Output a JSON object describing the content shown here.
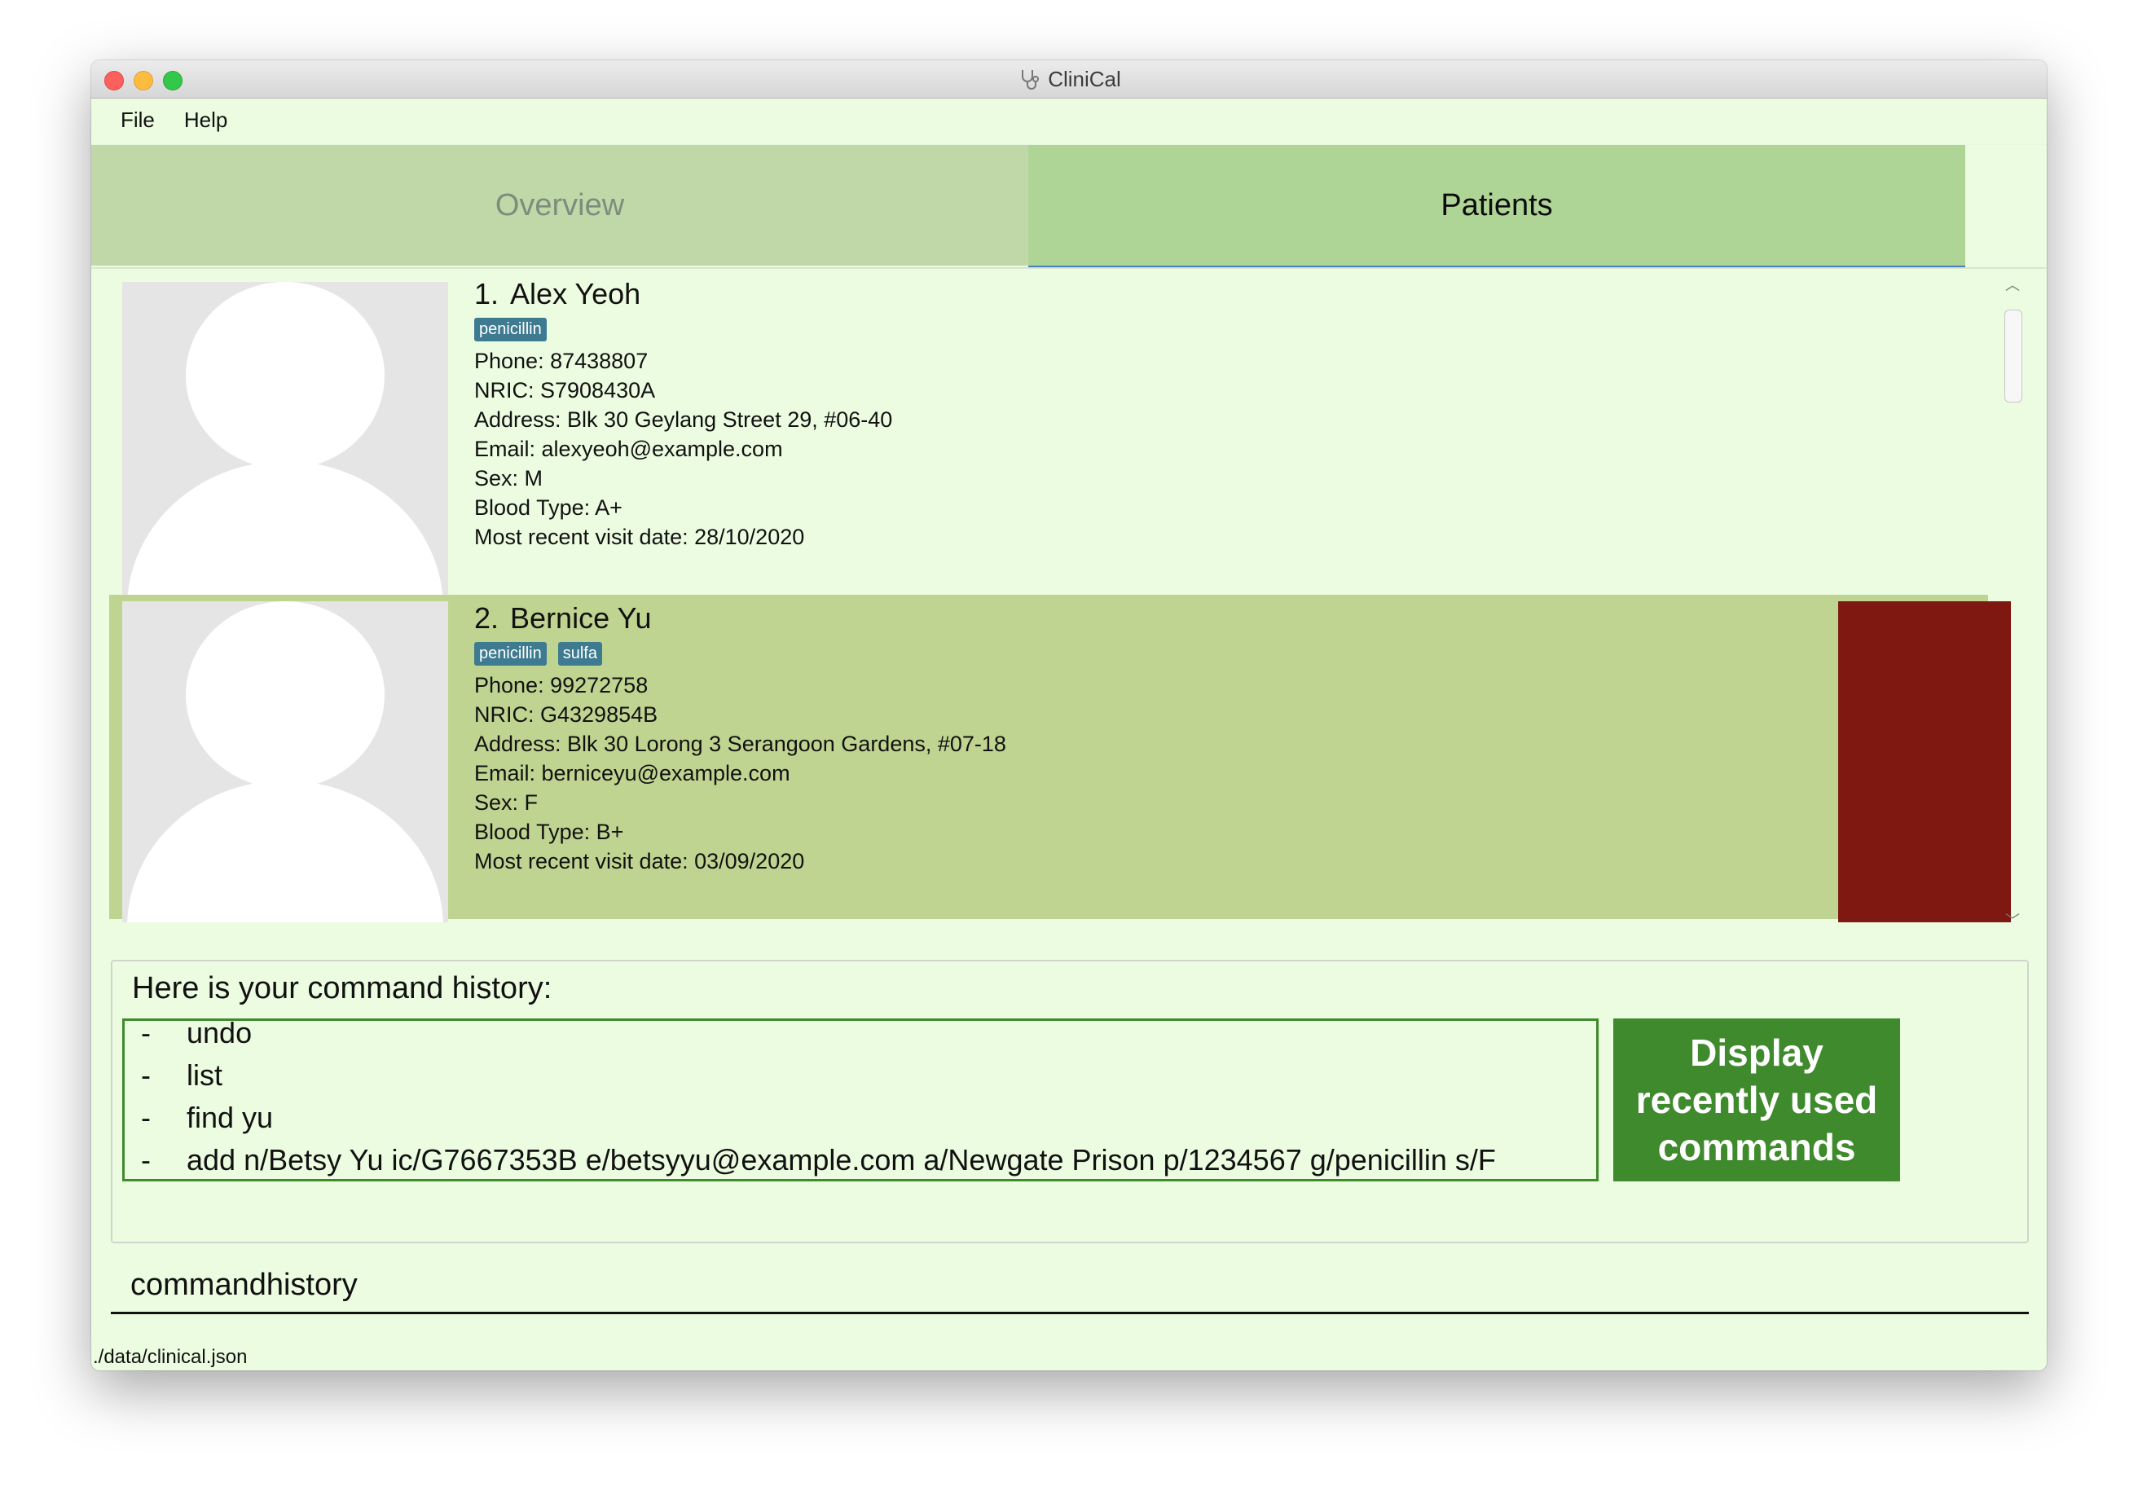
{
  "window": {
    "title": "CliniCal",
    "app_icon": "stethoscope-icon"
  },
  "menu": {
    "file": "File",
    "help": "Help"
  },
  "tabs": [
    {
      "label": "Overview",
      "selected": false
    },
    {
      "label": "Patients",
      "selected": true
    }
  ],
  "patients": [
    {
      "index": "1.",
      "name": "Alex Yeoh",
      "tags": [
        "penicillin"
      ],
      "phone": "Phone: 87438807",
      "nric": "NRIC: S7908430A",
      "address": "Address: Blk 30 Geylang Street 29, #06-40",
      "email": "Email: alexyeoh@example.com",
      "sex": "Sex: M",
      "blood_type": "Blood Type: A+",
      "visit": "Most recent visit date: 28/10/2020"
    },
    {
      "index": "2.",
      "name": "Bernice Yu",
      "tags": [
        "penicillin",
        "sulfa"
      ],
      "phone": "Phone: 99272758",
      "nric": "NRIC: G4329854B",
      "address": "Address: Blk 30 Lorong 3 Serangoon Gardens, #07-18",
      "email": "Email: berniceyu@example.com",
      "sex": "Sex: F",
      "blood_type": "Blood Type: B+",
      "visit": "Most recent visit date: 03/09/2020",
      "selected": true
    }
  ],
  "history": {
    "title": "Here is your command history:",
    "dash": "-",
    "items": [
      "undo",
      "list",
      "find yu",
      "add n/Betsy Yu ic/G7667353B e/betsyyu@example.com a/Newgate Prison p/1234567 g/penicillin s/F"
    ],
    "button_label": "Display recently used commands"
  },
  "command_box": {
    "value": "commandhistory"
  },
  "status_bar": {
    "path": "./data/clinical.json"
  },
  "colors": {
    "background": "#ecfce0",
    "tab_selected": "#afd596",
    "tab_unselected": "#c0d8a8",
    "card_selected": "#bfd490",
    "tag": "#3e7b91",
    "accent_green": "#3f8a2d",
    "alert_red": "#7e1810"
  }
}
